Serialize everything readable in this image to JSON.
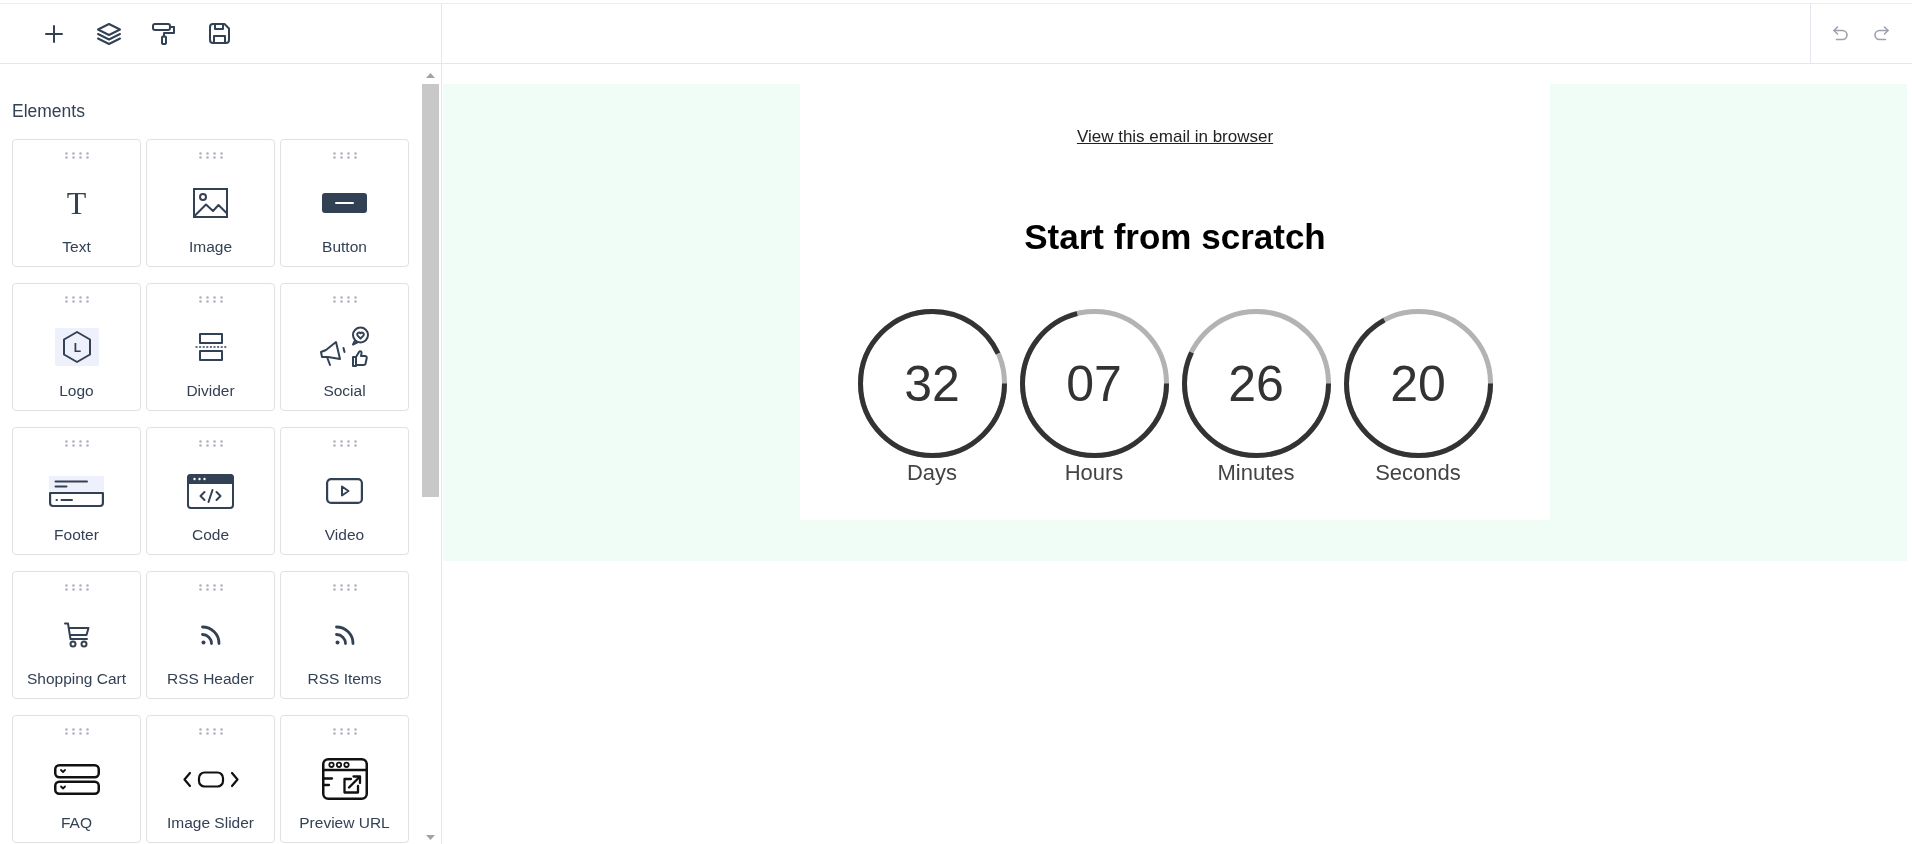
{
  "sidebar": {
    "heading": "Elements",
    "items": [
      {
        "label": "Text",
        "kind": "text",
        "icon_text": "T"
      },
      {
        "label": "Image",
        "kind": "image"
      },
      {
        "label": "Button",
        "kind": "button"
      },
      {
        "label": "Logo",
        "kind": "logo",
        "icon_text": "L"
      },
      {
        "label": "Divider",
        "kind": "divider"
      },
      {
        "label": "Social",
        "kind": "social"
      },
      {
        "label": "Footer",
        "kind": "footer"
      },
      {
        "label": "Code",
        "kind": "code"
      },
      {
        "label": "Video",
        "kind": "video"
      },
      {
        "label": "Shopping Cart",
        "kind": "cart"
      },
      {
        "label": "RSS Header",
        "kind": "rss"
      },
      {
        "label": "RSS Items",
        "kind": "rss"
      },
      {
        "label": "FAQ",
        "kind": "faq"
      },
      {
        "label": "Image Slider",
        "kind": "slider"
      },
      {
        "label": "Preview URL",
        "kind": "preview"
      }
    ]
  },
  "email": {
    "browser_link": "View this email in browser",
    "title": "Start from scratch",
    "countdown": [
      {
        "value": "32",
        "unit": "Days",
        "level": 0.93
      },
      {
        "value": "07",
        "unit": "Hours",
        "level": 0.71
      },
      {
        "value": "26",
        "unit": "Minutes",
        "level": 0.57
      },
      {
        "value": "20",
        "unit": "Seconds",
        "level": 0.67
      }
    ]
  }
}
